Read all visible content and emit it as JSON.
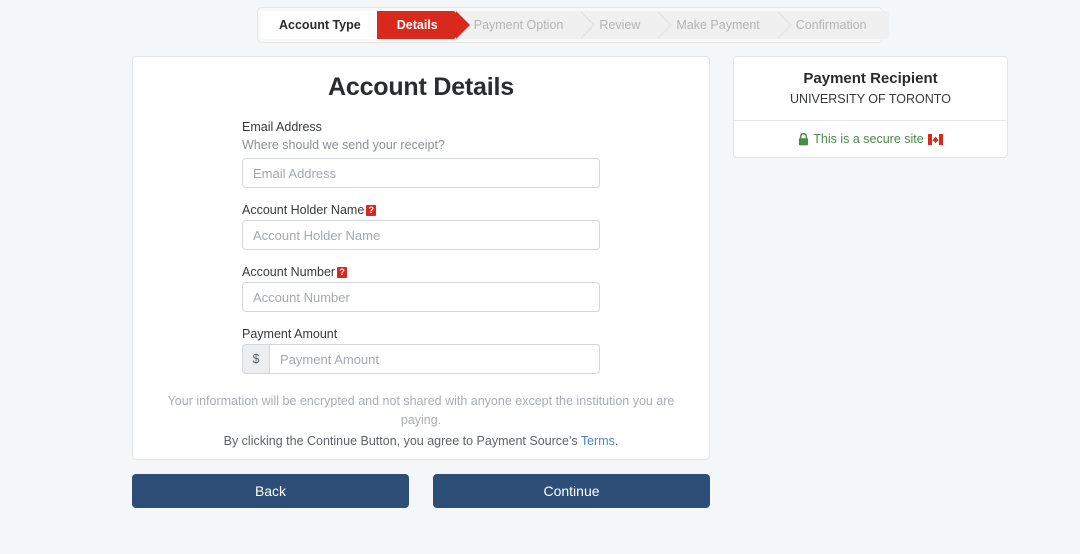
{
  "stepper": {
    "steps": [
      {
        "label": "Account Type",
        "state": "done"
      },
      {
        "label": "Details",
        "state": "active"
      },
      {
        "label": "Payment Option",
        "state": "upcoming"
      },
      {
        "label": "Review",
        "state": "upcoming"
      },
      {
        "label": "Make Payment",
        "state": "upcoming"
      },
      {
        "label": "Confirmation",
        "state": "upcoming"
      }
    ]
  },
  "form": {
    "title": "Account Details",
    "fields": {
      "email": {
        "label": "Email Address",
        "hint": "Where should we send your receipt?",
        "placeholder": "Email Address",
        "value": ""
      },
      "account_holder": {
        "label": "Account Holder Name",
        "help_badge": "?",
        "placeholder": "Account Holder Name",
        "value": ""
      },
      "account_number": {
        "label": "Account Number",
        "help_badge": "?",
        "placeholder": "Account Number",
        "value": ""
      },
      "payment_amount": {
        "label": "Payment Amount",
        "currency_symbol": "$",
        "placeholder": "Payment Amount",
        "value": ""
      }
    },
    "fine_print": "Your information will be encrypted and not shared with anyone except the institution you are paying.",
    "terms_prefix": "By clicking the Continue Button, you agree to Payment Source's ",
    "terms_link": "Terms",
    "terms_suffix": "."
  },
  "sidebar": {
    "title": "Payment Recipient",
    "recipient": "UNIVERSITY OF TORONTO",
    "secure_text": "This is a secure site",
    "lock_icon": "lock-icon",
    "flag_icon": "canada-flag-icon"
  },
  "actions": {
    "back_label": "Back",
    "continue_label": "Continue"
  },
  "colors": {
    "accent_red": "#d9291c",
    "button_blue": "#2d4f77",
    "link_blue": "#4a87c4",
    "secure_green": "#4b8a4b",
    "page_background": "#f5f6f8"
  }
}
